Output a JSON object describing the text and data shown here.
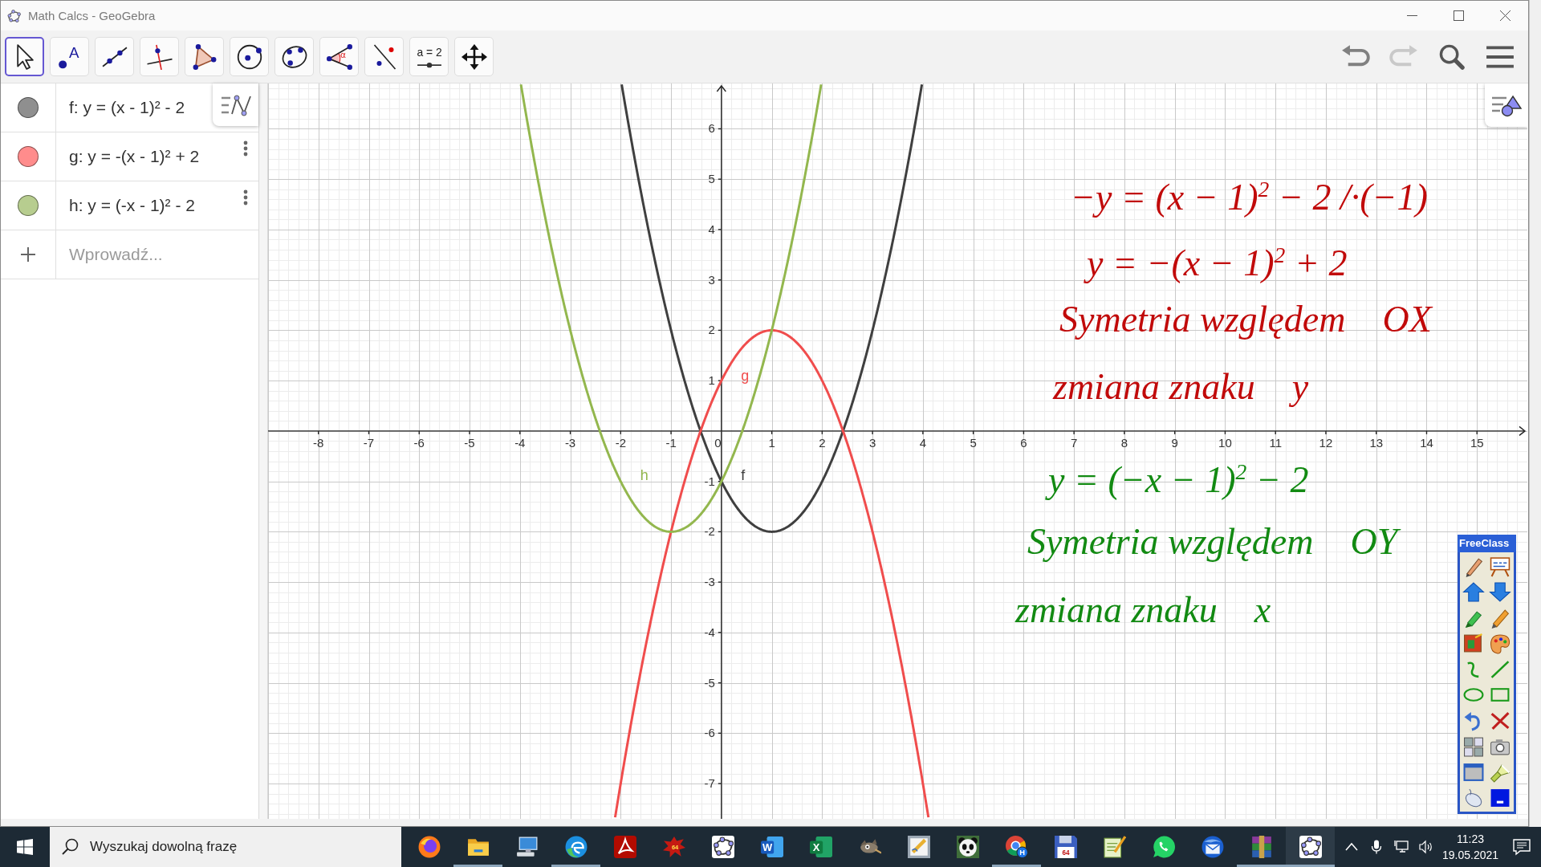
{
  "window": {
    "title": "Math Calcs - GeoGebra"
  },
  "toolbar": {
    "tools": [
      {
        "kind": "move",
        "selected": true
      },
      {
        "kind": "point",
        "selected": false,
        "text": "A"
      },
      {
        "kind": "line",
        "selected": false
      },
      {
        "kind": "perpendicular",
        "selected": false
      },
      {
        "kind": "polygon",
        "selected": false
      },
      {
        "kind": "circle",
        "selected": false
      },
      {
        "kind": "conic",
        "selected": false
      },
      {
        "kind": "angle",
        "selected": false,
        "text": "α"
      },
      {
        "kind": "reflect",
        "selected": false
      },
      {
        "kind": "slider",
        "selected": false,
        "text": "a = 2"
      },
      {
        "kind": "pan",
        "selected": false
      }
    ],
    "actions": [
      {
        "kind": "undo",
        "disabled": false
      },
      {
        "kind": "redo",
        "disabled": true
      },
      {
        "kind": "search",
        "disabled": false
      },
      {
        "kind": "menu",
        "disabled": false
      }
    ]
  },
  "algebra": {
    "items": [
      {
        "formula": "f: y = (x - 1)² - 2",
        "color": "#8f8f8f"
      },
      {
        "formula": "g: y = -(x - 1)² + 2",
        "color": "#ff8c8c"
      },
      {
        "formula": "h: y = (-x - 1)² - 2",
        "color": "#b7cd8f"
      }
    ],
    "input": {
      "placeholder": "Wprowadź..."
    }
  },
  "graphics": {
    "chart_data": {
      "type": "line",
      "x": [
        -3.98,
        -3.5,
        -3,
        -2.5,
        -2.11,
        -1.98,
        -1.5,
        -1,
        -0.5,
        0,
        0.5,
        1,
        1.5,
        1.98,
        2.5,
        3,
        3.5,
        3.98,
        4.11
      ],
      "series": [
        {
          "name": "f",
          "color": "#3f3f3f",
          "values": [
            null,
            null,
            null,
            null,
            null,
            6.88,
            4.25,
            2,
            0.25,
            -1,
            -1.75,
            -2,
            -1.75,
            -1.04,
            0.25,
            2,
            4.25,
            6.88,
            null
          ]
        },
        {
          "name": "g",
          "color": "#f04d4d",
          "values": [
            null,
            null,
            null,
            null,
            -7.67,
            -6.88,
            -4.25,
            -2,
            -0.25,
            1,
            1.75,
            2,
            1.75,
            1.04,
            -0.25,
            -2,
            -4.25,
            -6.88,
            -7.67
          ]
        },
        {
          "name": "h",
          "color": "#93b74e",
          "values": [
            6.88,
            4.25,
            2,
            0.25,
            -0.77,
            -1.04,
            -1.75,
            -2,
            -1.75,
            -1,
            0.25,
            2,
            4.25,
            6.88,
            null,
            null,
            null,
            null,
            null
          ]
        }
      ],
      "xlim": [
        -9,
        16
      ],
      "ylim": [
        -7.7,
        6.9
      ],
      "xticks": [
        -8,
        -7,
        -6,
        -5,
        -4,
        -3,
        -2,
        -1,
        0,
        1,
        2,
        3,
        4,
        5,
        6,
        7,
        8,
        9,
        10,
        11,
        12,
        13,
        14,
        15
      ],
      "yticks": [
        -7,
        -6,
        -5,
        -4,
        -3,
        -2,
        -1,
        1,
        2,
        3,
        4,
        5,
        6
      ],
      "grid": true
    },
    "ink": [
      {
        "color": "#c10a0a",
        "lines": [
          [
            "−y = (x − 1)$^{2}$ − 2 /·(−1)"
          ],
          [
            "y = −(x − 1)$^{2}$ + 2"
          ],
          [
            "Symetria względem",
            "OX"
          ],
          [
            "zmiana znaku",
            "y"
          ]
        ]
      },
      {
        "color": "#128a12",
        "lines": [
          [
            "y = (−x − 1)$^{2}$ − 2"
          ],
          [
            "Symetria względem",
            "OY"
          ],
          [
            "zmiana znaku",
            "x"
          ]
        ]
      }
    ]
  },
  "palette": {
    "title": "FreeClass"
  },
  "taskbar": {
    "search": {
      "placeholder": "Wyszukaj dowolną frazę"
    },
    "apps": [
      {
        "kind": "globe",
        "running": false,
        "selected": false
      },
      {
        "kind": "folder",
        "running": true,
        "selected": false
      },
      {
        "kind": "computer",
        "running": false,
        "selected": false
      },
      {
        "kind": "swirl",
        "running": true,
        "selected": false
      },
      {
        "kind": "pdf",
        "running": false,
        "selected": false
      },
      {
        "kind": "bug",
        "running": false,
        "selected": false,
        "text": "64"
      },
      {
        "kind": "geometry",
        "running": false,
        "selected": false
      },
      {
        "kind": "word",
        "running": false,
        "selected": false,
        "text": "W"
      },
      {
        "kind": "sheet",
        "running": false,
        "selected": false,
        "text": "X"
      },
      {
        "kind": "creature",
        "running": false,
        "selected": false
      },
      {
        "kind": "sketch",
        "running": false,
        "selected": false
      },
      {
        "kind": "panda",
        "running": false,
        "selected": false
      },
      {
        "kind": "wheel",
        "running": true,
        "selected": false,
        "text": "H"
      },
      {
        "kind": "floppy",
        "running": false,
        "selected": false,
        "text": "64"
      },
      {
        "kind": "notepad",
        "running": false,
        "selected": false
      },
      {
        "kind": "chat",
        "running": false,
        "selected": false
      },
      {
        "kind": "mail",
        "running": false,
        "selected": false
      },
      {
        "kind": "books",
        "running": true,
        "selected": false
      },
      {
        "kind": "geometry",
        "running": true,
        "selected": true
      }
    ],
    "clock": {
      "time": "11:23",
      "date": "19.05.2021"
    }
  }
}
